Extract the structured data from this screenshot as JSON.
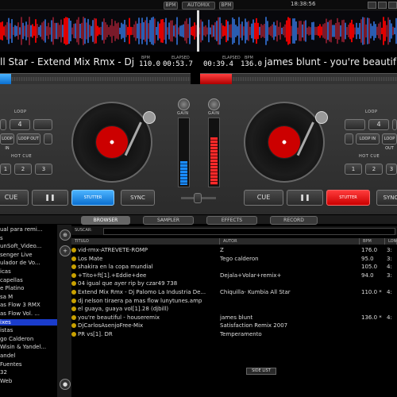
{
  "topbar": {
    "btn_a": "BPM",
    "btn_b": "AUTOMIX",
    "btn_c": "BPM",
    "clock": "18:38:56"
  },
  "deck_left": {
    "title": "ll Star - Extend Mix Rmx - Dj",
    "bpm_label": "BPM",
    "bpm": "110.0",
    "elapsed_label": "ELAPSED",
    "elapsed": "00:53.7"
  },
  "deck_right": {
    "title": "james blunt - you're beautiful",
    "bpm_label": "BPM",
    "bpm": "136.0",
    "elapsed_label": "ELAPSED",
    "elapsed": "00:39.4"
  },
  "controls": {
    "loop": "LOOP",
    "loop_value": "4",
    "loop_in": "LOOP IN",
    "loop_out": "LOOP OUT",
    "hot_cue": "HOT CUE",
    "hc1": "1",
    "hc2": "2",
    "hc3": "3",
    "cue": "CUE",
    "pause": "❚❚",
    "stutter": "STUTTER",
    "sync": "SYNC",
    "gain": "GAIN"
  },
  "tabs": {
    "browser": "BROWSER",
    "sampler": "SAMPLER",
    "effects": "EFFECTS",
    "record": "RECORD"
  },
  "folders": [
    "ual para remi...",
    "s",
    "unSoft_Video...",
    "senger Live",
    "ulador de Vo...",
    "icas",
    "capellas",
    "e Platino",
    "sa M",
    "as Flow 3 RMX",
    "as Flow Vol. ...",
    "ixes",
    "istas",
    "go Calderon",
    "Wisin & Yandel...",
    "andel",
    "Fuentes",
    "32",
    "Web"
  ],
  "search_label": "SUSCAR:",
  "columns": {
    "title": "TITULO",
    "author": "AUTOR",
    "bpm": "BPM",
    "length": "LONG"
  },
  "tracks": [
    {
      "title": "vid-rmx-ATREVETE-ROMP",
      "author": "Z",
      "bpm": "176.0",
      "len": "3:"
    },
    {
      "title": "Los Mate",
      "author": "Tego calderon",
      "bpm": "95.0",
      "len": "3:"
    },
    {
      "title": "shakira en la copa mundial",
      "author": "",
      "bpm": "105.0",
      "len": "4:"
    },
    {
      "title": "+Tito+ft[1].+Eddie+dee",
      "author": "Dejala+Volar+remix+",
      "bpm": "94.0",
      "len": "3:"
    },
    {
      "title": "04 igual que ayer  rip by czar49  738",
      "author": "",
      "bpm": "",
      "len": ""
    },
    {
      "title": "Extend Mix Rmx - Dj Palomo La Industria De...",
      "author": "Chiquilla- Kumbia All Star",
      "bpm": "110.0 *",
      "len": "4:"
    },
    {
      "title": "dj nelson tiraera pa mas flow lunytunes.amp",
      "author": "",
      "bpm": "",
      "len": ""
    },
    {
      "title": "el guaya, guaya vol[1].28 (djbill)",
      "author": "",
      "bpm": "",
      "len": ""
    },
    {
      "title": "you're beautiful - houseremix",
      "author": "james blunt",
      "bpm": "136.0 *",
      "len": "4:"
    },
    {
      "title": "DjCarlosAsenjoFree-Mix",
      "author": "Satisfaction Remix 2007",
      "bpm": "",
      "len": ""
    },
    {
      "title": "PR vs[1]. DR",
      "author": "Temperamento",
      "bpm": "",
      "len": ""
    }
  ],
  "sidelist": "SIDE LIST",
  "colors": {
    "accent_red": "#e00000",
    "accent_blue": "#1a7fe0",
    "selection": "#1a3ccc"
  }
}
